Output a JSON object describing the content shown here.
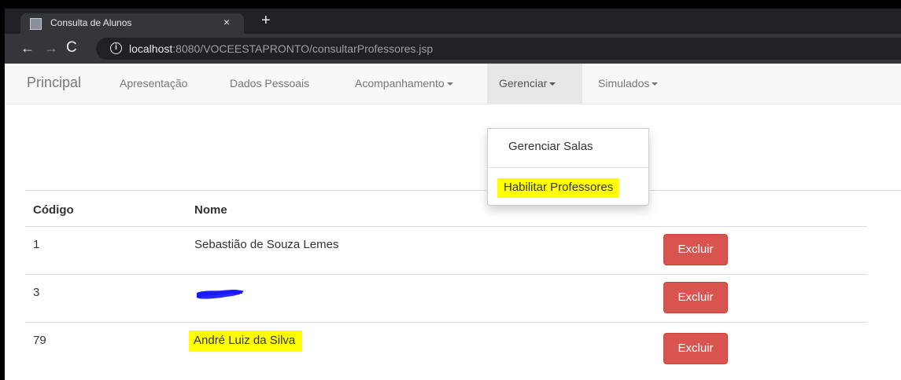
{
  "browser": {
    "tab_title": "Consulta de Alunos",
    "tab_close": "×",
    "new_tab": "+",
    "url_host": "localhost",
    "url_rest": ":8080/VOCEESTAPRONTO/consultarProfessores.jsp",
    "back": "←",
    "forward": "→",
    "reload": "C",
    "info": "i"
  },
  "navbar": {
    "brand": "Principal",
    "items": [
      {
        "label": "Apresentação"
      },
      {
        "label": "Dados Pessoais"
      },
      {
        "label": "Acompanhamento"
      },
      {
        "label": "Gerenciar"
      },
      {
        "label": "Simulados"
      }
    ]
  },
  "dropdown": {
    "items": [
      {
        "label": "Gerenciar Salas"
      },
      {
        "label": "Habilitar Professores",
        "highlighted": true
      }
    ]
  },
  "table": {
    "headers": [
      "Código",
      "Nome"
    ],
    "rows": [
      {
        "codigo": "1",
        "nome": "Sebastião de Souza Lemes",
        "action": "Excluir"
      },
      {
        "codigo": "3",
        "nome": "",
        "redacted": true,
        "action": "Excluir"
      },
      {
        "codigo": "79",
        "nome": "André Luiz da Silva",
        "highlighted": true,
        "action": "Excluir"
      }
    ]
  },
  "colors": {
    "danger": "#d9534f",
    "highlight": "#ffff00",
    "redaction": "#1a1aff"
  },
  "icons": [
    "favicon-icon",
    "close-icon",
    "plus-icon",
    "back-arrow-icon",
    "forward-arrow-icon",
    "reload-icon",
    "info-icon",
    "caret-down-icon"
  ]
}
